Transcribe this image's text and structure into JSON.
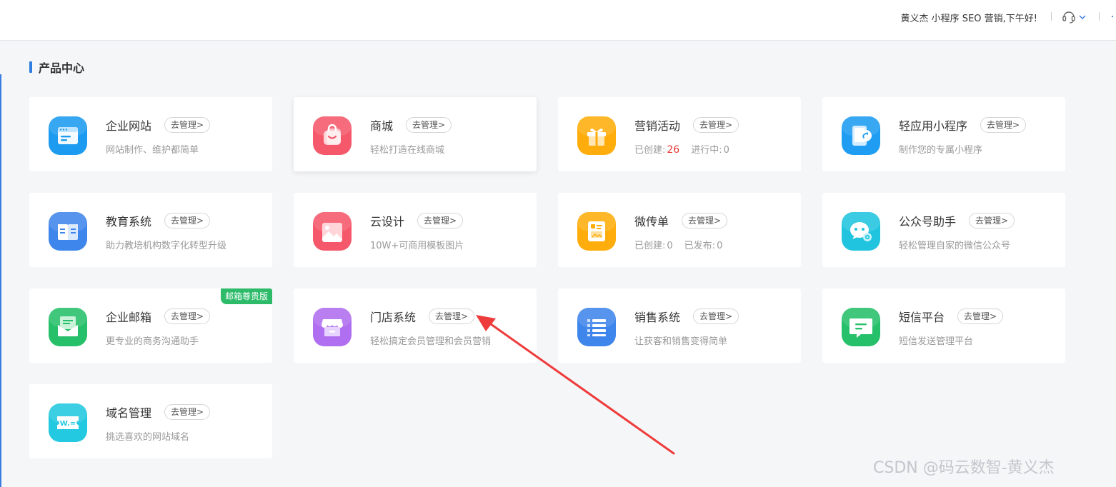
{
  "header": {
    "greeting": "黄义杰  小程序  SEO  营销,下午好!"
  },
  "section": {
    "title": "产品中心"
  },
  "manage_label": "去管理>",
  "cards": [
    {
      "name": "企业网站",
      "desc": "网站制作、维护都简单",
      "icon": "website-icon",
      "color": "#1c9bf0"
    },
    {
      "name": "商城",
      "desc": "轻松打造在线商城",
      "icon": "shopping-bag-icon",
      "color": "#f5586a"
    },
    {
      "name": "营销活动",
      "stats": {
        "created_label": "已创建:",
        "created_value": "26",
        "running_label": "进行中:",
        "running_value": "0"
      },
      "icon": "gift-icon",
      "color": "#ffad0d"
    },
    {
      "name": "轻应用小程序",
      "desc": "制作您的专属小程序",
      "icon": "mini-program-icon",
      "color": "#1e9df2"
    },
    {
      "name": "教育系统",
      "desc": "助力教培机构数字化转型升级",
      "icon": "book-icon",
      "color": "#3f86ec"
    },
    {
      "name": "云设计",
      "desc": "10W+可商用模板图片",
      "icon": "image-icon",
      "color": "#f5586a"
    },
    {
      "name": "微传单",
      "stats": {
        "created_label": "已创建:",
        "created_value": "0",
        "published_label": "已发布:",
        "published_value": "0"
      },
      "icon": "flyer-icon",
      "color": "#ffad0d"
    },
    {
      "name": "公众号助手",
      "desc": "轻松管理自家的微信公众号",
      "icon": "wechat-icon",
      "color": "#20c4de"
    },
    {
      "name": "企业邮箱",
      "desc": "更专业的商务沟通助手",
      "badge": "邮箱尊贵版",
      "icon": "mail-icon",
      "color": "#27c06a"
    },
    {
      "name": "门店系统",
      "desc": "轻松搞定会员管理和会员营销",
      "icon": "store-icon",
      "color": "#b06ef0"
    },
    {
      "name": "销售系统",
      "desc": "让获客和销售变得简单",
      "icon": "list-icon",
      "color": "#3f86ec"
    },
    {
      "name": "短信平台",
      "desc": "短信发送管理平台",
      "icon": "sms-icon",
      "color": "#27c06a"
    },
    {
      "name": "域名管理",
      "desc": "挑选喜欢的网站域名",
      "icon": "domain-icon",
      "color": "#22c9e0",
      "icon_text": "W.="
    }
  ],
  "watermark": "CSDN @码云数智-黄义杰",
  "accent": "#2f7de1",
  "annotation_color": "#ee3b3b"
}
